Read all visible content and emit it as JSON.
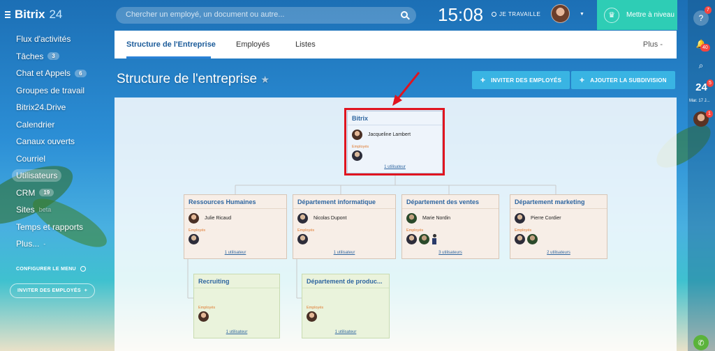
{
  "topbar": {
    "logo_main": "Bitrix",
    "logo_num": "24",
    "search_placeholder": "Chercher un employé, un document ou autre...",
    "clock": "15:08",
    "work_status": "JE TRAVAILLE",
    "upgrade_label": "Mettre à niveau"
  },
  "sidebar": {
    "items": [
      {
        "label": "Flux d'activités",
        "count": ""
      },
      {
        "label": "Tâches",
        "count": "3"
      },
      {
        "label": "Chat et Appels",
        "count": "6"
      },
      {
        "label": "Groupes de travail",
        "count": ""
      },
      {
        "label": "Bitrix24.Drive",
        "count": ""
      },
      {
        "label": "Calendrier",
        "count": ""
      },
      {
        "label": "Canaux ouverts",
        "count": ""
      },
      {
        "label": "Courriel",
        "count": ""
      },
      {
        "label": "Utilisateurs",
        "count": ""
      },
      {
        "label": "CRM",
        "count": "19"
      },
      {
        "label": "Sites",
        "count": ""
      },
      {
        "label": "Temps et rapports",
        "count": ""
      },
      {
        "label": "Plus...",
        "count": ""
      }
    ],
    "sites_beta": "beta",
    "configure_menu": "CONFIGURER LE MENU",
    "invite_employees": "INVITER DES EMPLOYÉS"
  },
  "rightbar": {
    "help": "?",
    "help_badge": "7",
    "notif_badge": "40",
    "date_num": "24",
    "date_badge": "5",
    "date_sub": "Mar. 17 J...",
    "avatar_badge": "1"
  },
  "tabs": {
    "items": [
      "Structure de l'Entreprise",
      "Employés",
      "Listes"
    ],
    "more": "Plus -"
  },
  "page": {
    "title": "Structure de l'entreprise",
    "star": "★",
    "invite_button": "INVITER DES EMPLOYÉS",
    "add_subdivision_button": "AJOUTER LA SUBDIVISION"
  },
  "org": {
    "top": {
      "name": "Bitrix",
      "head": "Jacqueline Lambert",
      "employees_label": "Employés",
      "link": "1 utilisateur"
    },
    "departments": [
      {
        "name": "Ressources Humaines",
        "head": "Julie Ricaud",
        "employees_label": "Employés",
        "link": "1 utilisateur"
      },
      {
        "name": "Département informatique",
        "head": "Nicolas Dupont",
        "employees_label": "Employés",
        "link": "1 utilisateur"
      },
      {
        "name": "Département des ventes",
        "head": "Marie Nordin",
        "employees_label": "Employés",
        "link": "3 utilisateurs"
      },
      {
        "name": "Département marketing",
        "head": "Pierre Cordier",
        "employees_label": "Employés",
        "link": "2 utilisateurs"
      }
    ],
    "subdepartments": [
      {
        "name": "Recruiting",
        "employees_label": "Employés",
        "link": "1 utilisateur"
      },
      {
        "name": "Département de produc...",
        "employees_label": "Employés",
        "link": "1 utilisateur"
      }
    ]
  },
  "colors": {
    "accent": "#2a82d6",
    "button": "#39b4e3",
    "upgrade": "#2ecdb5",
    "highlight": "#e0141f",
    "badge": "#f5453f"
  }
}
